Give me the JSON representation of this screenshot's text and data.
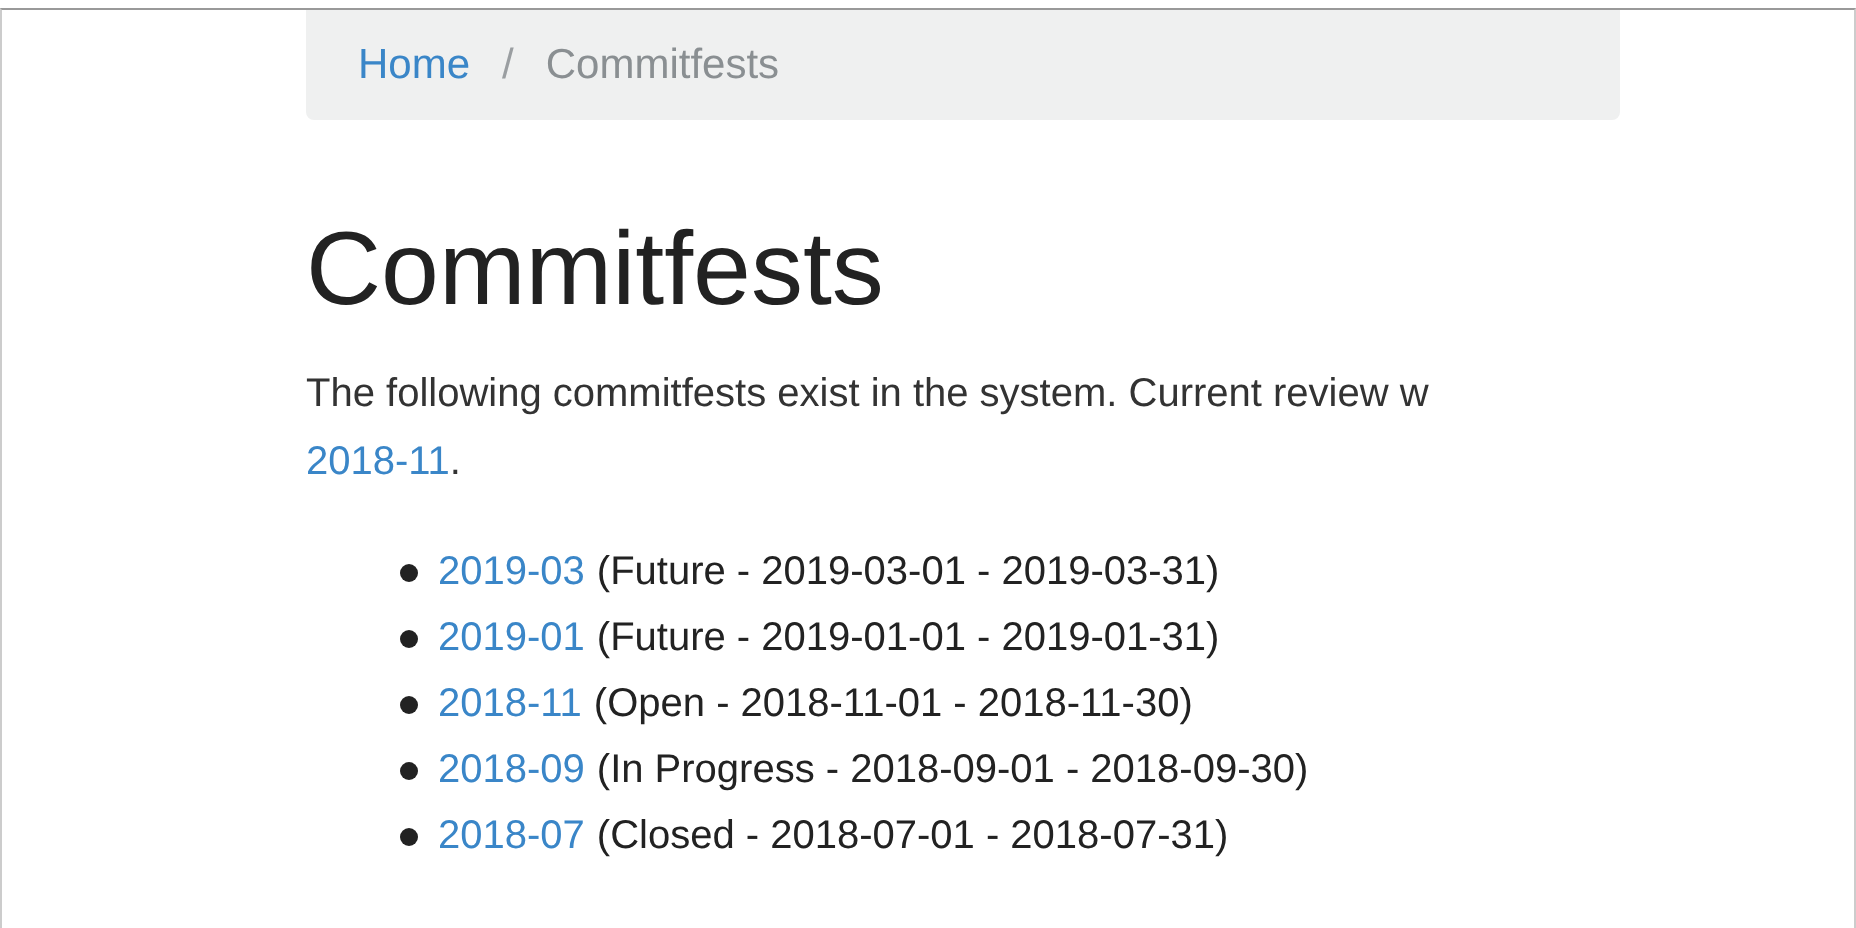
{
  "breadcrumb": [
    {
      "label": "Home",
      "kind": "link"
    },
    {
      "label": "Commitfests",
      "kind": "current"
    }
  ],
  "breadcrumb_separator": "/",
  "title": "Commitfests",
  "intro": {
    "text": "The following commitfests exist in the system. Current review w",
    "link": "2018-11",
    "suffix": "."
  },
  "commitfests": [
    {
      "name": "2019-03",
      "details": "(Future - 2019-03-01 - 2019-03-31)"
    },
    {
      "name": "2019-01",
      "details": "(Future - 2019-01-01 - 2019-01-31)"
    },
    {
      "name": "2018-11",
      "details": "(Open - 2018-11-01 - 2018-11-30)"
    },
    {
      "name": "2018-09",
      "details": "(In Progress - 2018-09-01 - 2018-09-30)"
    },
    {
      "name": "2018-07",
      "details": "(Closed - 2018-07-01 - 2018-07-31)"
    }
  ]
}
